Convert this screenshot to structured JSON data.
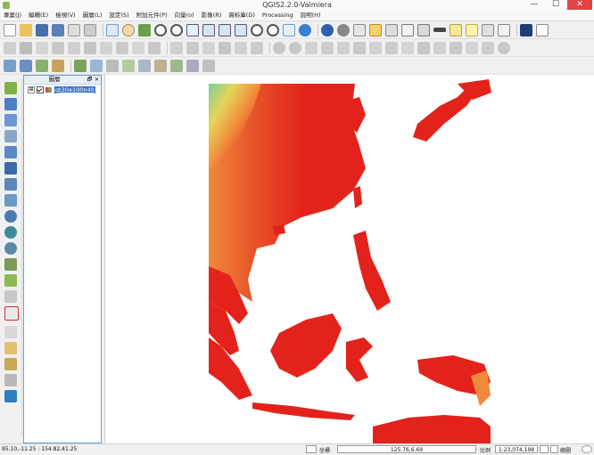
{
  "window": {
    "title": "QGIS2.2.0-Valmiera",
    "minimize": "—",
    "maximize": "☐",
    "close": "✕"
  },
  "menu": [
    "專案(J)",
    "編輯(E)",
    "檢視(V)",
    "圖層(L)",
    "設定(S)",
    "附加元件(P)",
    "向量(o)",
    "影像(R)",
    "資料庫(D)",
    "Processing",
    "說明(H)"
  ],
  "layers_panel": {
    "title": "圖層",
    "float_button": "🗗",
    "close_button": "✕",
    "expander": "⊞",
    "layer_name": "gt30e100n40"
  },
  "status": {
    "coordinate": "95.10,-11.25 : 154.82,41.25",
    "coord_label": "坐標",
    "coord_value": "125.76,6.69",
    "scale_label": "比例",
    "scale_value": "1:23,074,198",
    "render_label": "繪圖"
  },
  "colors": {
    "map_red": "#e3231b",
    "map_orange": "#f08a3a",
    "map_yellow": "#e6d45a",
    "map_green": "#86c98a",
    "panel_border": "#6a9fd4",
    "selection_blue": "#3a72c8"
  },
  "icons": {
    "map": "raster-map-icon"
  }
}
